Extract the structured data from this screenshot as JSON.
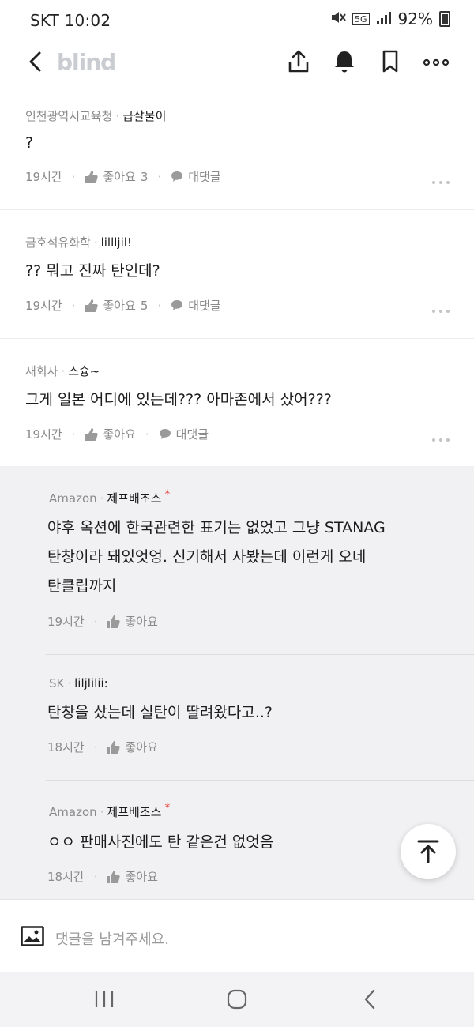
{
  "status": {
    "time": "SKT 10:02",
    "network": "5G",
    "battery": "92%"
  },
  "appbar": {
    "logo": "blind"
  },
  "comments": [
    {
      "company": "인천광역시교육청",
      "nick": "급살물이",
      "text": "?",
      "time": "19시간",
      "like_label": "좋아요",
      "like_count": "3",
      "reply_label": "대댓글"
    },
    {
      "company": "금호석유화학",
      "nick": "lillljil!",
      "text": "?? 뭐고 진짜 탄인데?",
      "time": "19시간",
      "like_label": "좋아요",
      "like_count": "5",
      "reply_label": "대댓글"
    },
    {
      "company": "새회사",
      "nick": "스슝~",
      "text": "그게 일본 어디에 있는데??? 아마존에서 샀어???",
      "time": "19시간",
      "like_label": "좋아요",
      "like_count": "",
      "reply_label": "대댓글"
    }
  ],
  "replies": [
    {
      "company": "Amazon",
      "nick": "제프배조스",
      "author_mark": "*",
      "lines": [
        "야후 옥션에 한국관련한 표기는 없었고 그냥 STANAG",
        "탄창이라 돼있엇엉. 신기해서 사봤는데 이런게 오네",
        "탄클립까지"
      ],
      "time": "19시간",
      "like_label": "좋아요"
    },
    {
      "company": "SK",
      "nick": "liljlilii:",
      "author_mark": "",
      "lines": [
        "탄창을 샀는데 실탄이 딸려왔다고..?"
      ],
      "time": "18시간",
      "like_label": "좋아요"
    },
    {
      "company": "Amazon",
      "nick": "제프배조스",
      "author_mark": "*",
      "lines": [
        "ㅇㅇ 판매사진에도 탄 같은건 없엇음"
      ],
      "time": "18시간",
      "like_label": "좋아요"
    }
  ],
  "input": {
    "placeholder": "댓글을 남겨주세요."
  },
  "colors": {
    "accent_star": "#e53935",
    "reply_bg": "#f1f1f3",
    "muted": "#8a8a8a"
  }
}
